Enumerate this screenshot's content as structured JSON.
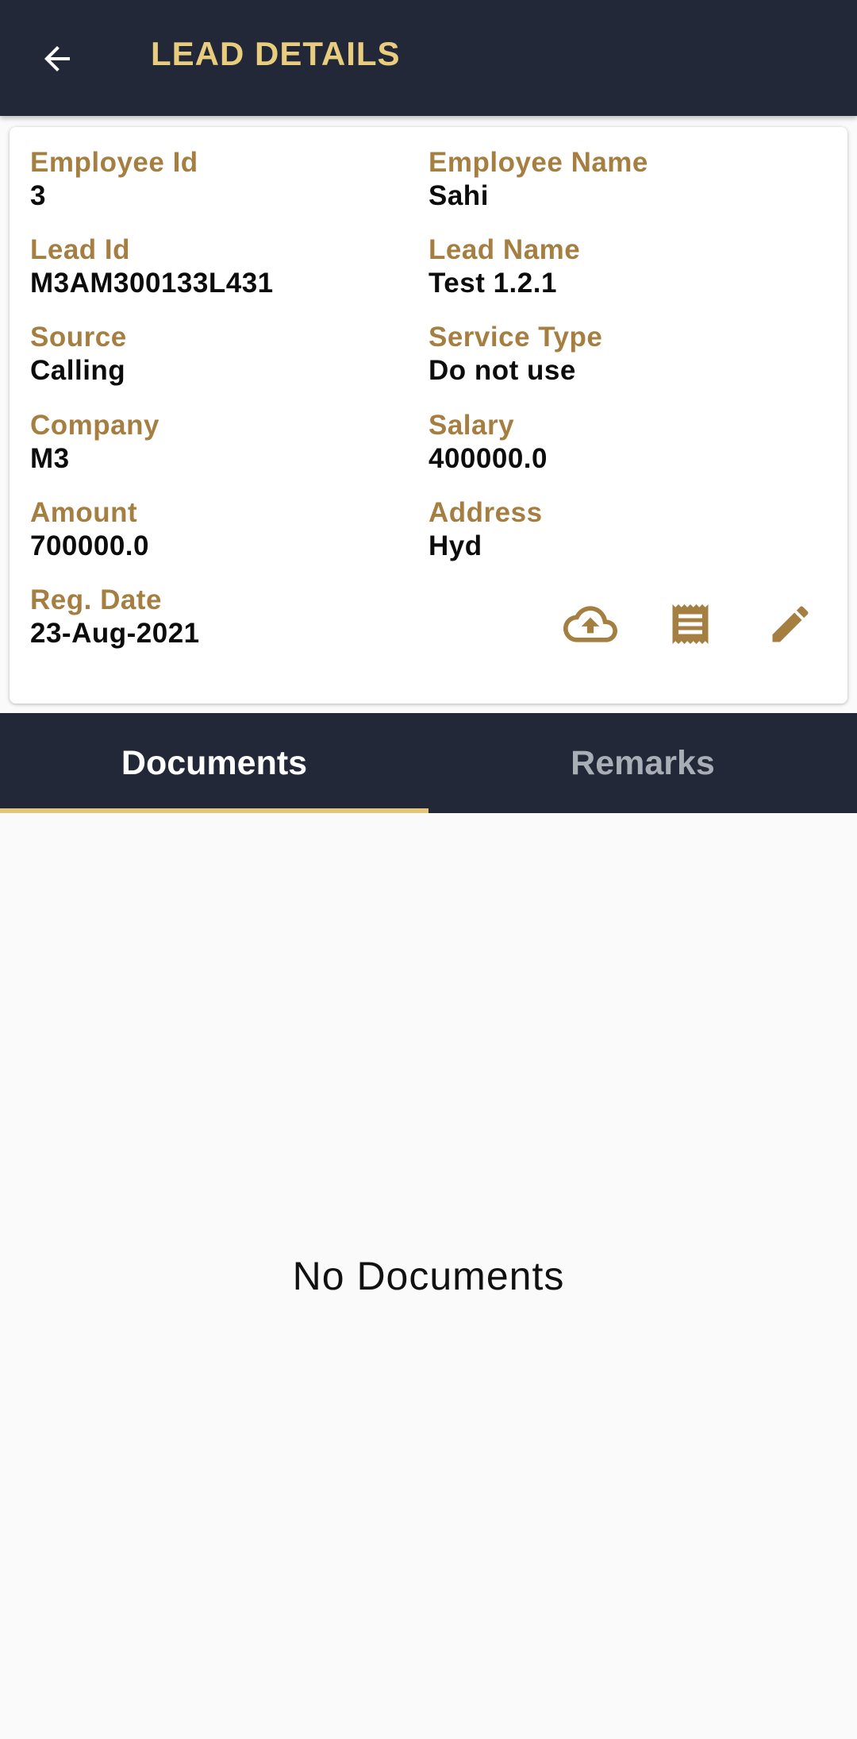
{
  "appbar": {
    "title": "LEAD DETAILS",
    "back_icon": "arrow-back-icon"
  },
  "lead": {
    "fields": [
      {
        "label": "Employee Id",
        "value": "3"
      },
      {
        "label": "Employee Name",
        "value": "Sahi"
      },
      {
        "label": "Lead Id",
        "value": "M3AM300133L431"
      },
      {
        "label": "Lead Name",
        "value": "Test 1.2.1"
      },
      {
        "label": "Source",
        "value": "Calling"
      },
      {
        "label": "Service Type",
        "value": "Do not use"
      },
      {
        "label": "Company",
        "value": "M3"
      },
      {
        "label": "Salary",
        "value": "400000.0"
      },
      {
        "label": "Amount",
        "value": "700000.0"
      },
      {
        "label": "Address",
        "value": "Hyd"
      },
      {
        "label": "Reg. Date",
        "value": "23-Aug-2021"
      }
    ],
    "actions": [
      "cloud-upload-icon",
      "receipt-icon",
      "edit-pencil-icon"
    ]
  },
  "tabs": [
    {
      "label": "Documents",
      "active": true
    },
    {
      "label": "Remarks",
      "active": false
    }
  ],
  "documents": {
    "empty_message": "No Documents"
  },
  "colors": {
    "appbar_bg": "#222838",
    "title": "#e9cd7e",
    "label": "#a57f42",
    "tab_indicator": "#e2c67c"
  }
}
